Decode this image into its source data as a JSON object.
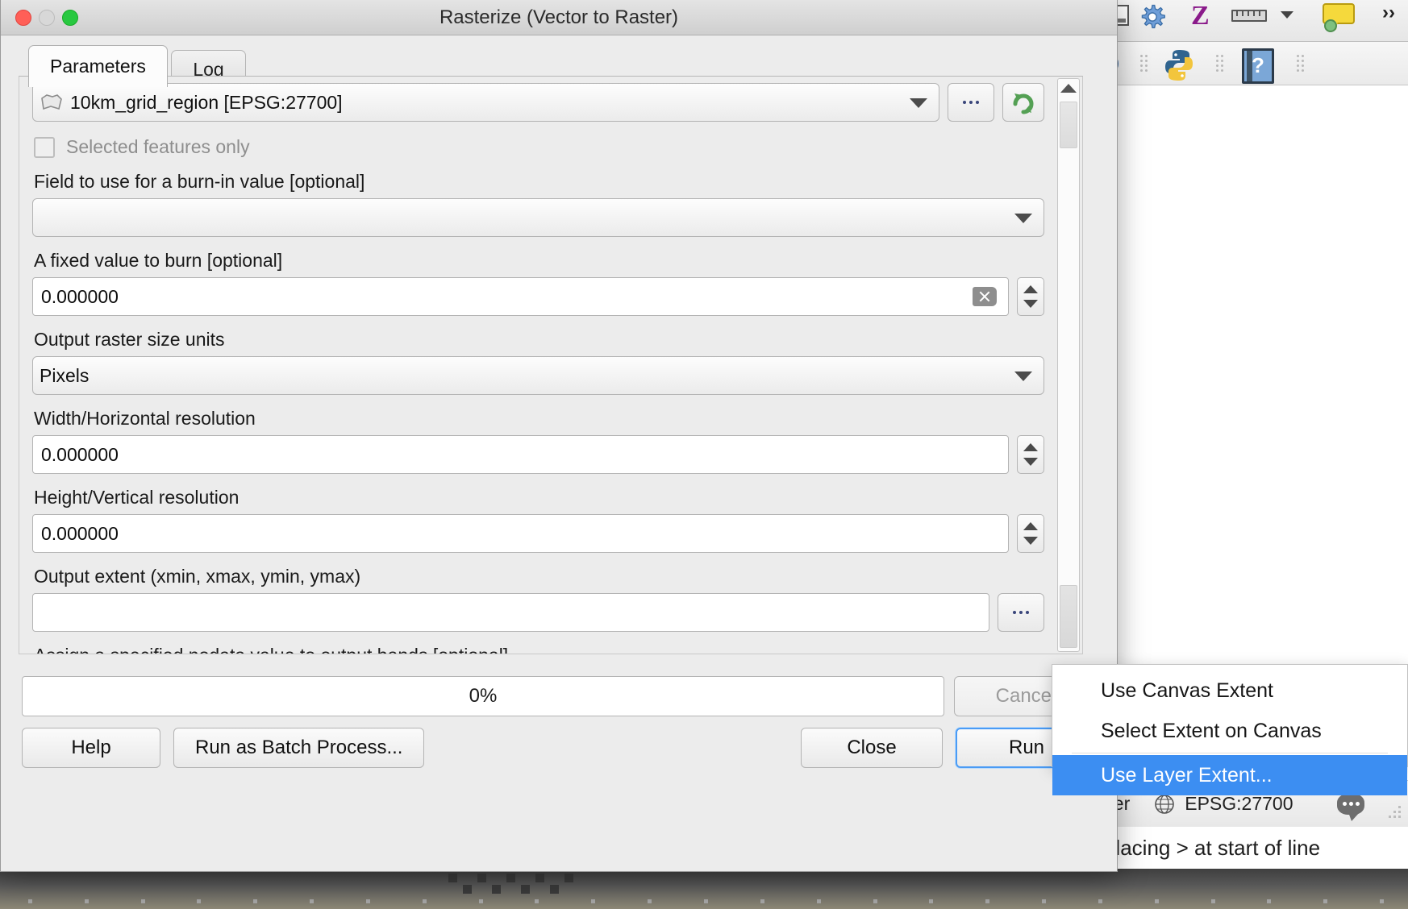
{
  "window": {
    "title": "Rasterize (Vector to Raster)",
    "traffic_lights": [
      "close",
      "minimize",
      "zoom"
    ]
  },
  "tabs": [
    {
      "label": "Parameters",
      "active": true
    },
    {
      "label": "Log",
      "active": false
    }
  ],
  "parameters": {
    "input_layer": {
      "value": "10km_grid_region [EPSG:27700]",
      "browse_label": "...",
      "iterate_label": "iterate"
    },
    "selected_features_only": {
      "label": "Selected features only",
      "checked": false,
      "enabled": false
    },
    "burn_field": {
      "label": "Field to use for a burn-in value [optional]",
      "value": ""
    },
    "fixed_value": {
      "label": "A fixed value to burn [optional]",
      "value": "0.000000"
    },
    "size_units": {
      "label": "Output raster size units",
      "value": "Pixels"
    },
    "width": {
      "label": "Width/Horizontal resolution",
      "value": "0.000000"
    },
    "height": {
      "label": "Height/Vertical resolution",
      "value": "0.000000"
    },
    "output_extent": {
      "label": "Output extent (xmin, xmax, ymin, ymax)",
      "value": "",
      "browse_label": "..."
    },
    "nodata": {
      "label": "Assign a specified nodata value to output bands [optional]"
    }
  },
  "progress": {
    "text": "0%",
    "percent": 0
  },
  "buttons": {
    "help": "Help",
    "run_batch": "Run as Batch Process...",
    "cancel": "Cancel",
    "close": "Close",
    "run": "Run"
  },
  "context_menu": {
    "items": [
      {
        "label": "Use Canvas Extent",
        "selected": false
      },
      {
        "label": "Select Extent on Canvas",
        "selected": false
      },
      {
        "label": "Use Layer Extent...",
        "selected": true
      }
    ],
    "highlight_color": "#3c8ef2"
  },
  "qgis_background": {
    "statusbar": {
      "render_label": "der",
      "crs_label": "EPSG:27700"
    },
    "console_tip": "quote by placing > at start of line",
    "toolbar_icons": [
      "gear-icon",
      "zed-icon",
      "ruler-icon",
      "chevron-down-icon",
      "tip-bubble-icon",
      "python-console-icon",
      "help-book-icon",
      "globe-icon",
      "message-bubble-icon"
    ]
  }
}
